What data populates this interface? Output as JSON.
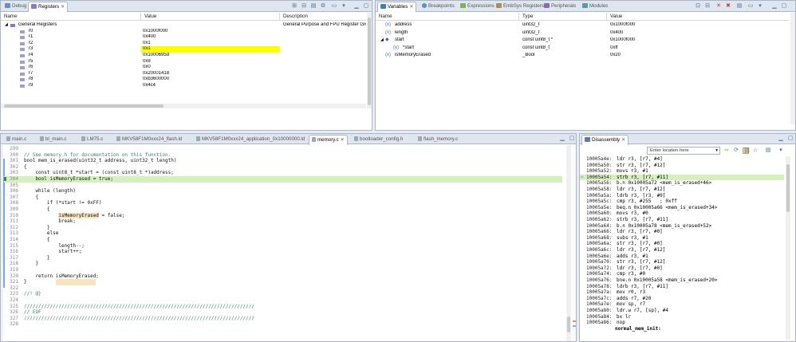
{
  "debug_view": {
    "tabs": [
      {
        "label": "Debug",
        "active": false
      },
      {
        "label": "Registers",
        "active": true
      }
    ],
    "columns": [
      "Name",
      "Value",
      "Description"
    ],
    "rows": [
      {
        "name": "General Registers",
        "value": "",
        "desc": "General Purpose and FPU Register Gro",
        "level": 0
      },
      {
        "name": "r0",
        "value": "0x1000f000",
        "desc": "",
        "level": 1
      },
      {
        "name": "r1",
        "value": "0x400",
        "desc": "",
        "level": 1
      },
      {
        "name": "r2",
        "value": "0x1",
        "desc": "",
        "level": 1
      },
      {
        "name": "r3",
        "value": "0x1",
        "desc": "",
        "level": 1,
        "highlight": true
      },
      {
        "name": "r4",
        "value": "0x1000695d",
        "desc": "",
        "level": 1
      },
      {
        "name": "r5",
        "value": "0x9",
        "desc": "",
        "level": 1
      },
      {
        "name": "r6",
        "value": "0x0",
        "desc": "",
        "level": 1
      },
      {
        "name": "r7",
        "value": "0x20001418",
        "desc": "",
        "level": 1
      },
      {
        "name": "r8",
        "value": "0xb3600000",
        "desc": "",
        "level": 1
      },
      {
        "name": "r9",
        "value": "0x4c4",
        "desc": "",
        "level": 1
      }
    ]
  },
  "variables_view": {
    "tabs": [
      {
        "label": "Variables",
        "active": true
      },
      {
        "label": "Breakpoints",
        "active": false
      },
      {
        "label": "Expressions",
        "active": false
      },
      {
        "label": "EmbSys Registers",
        "active": false
      },
      {
        "label": "Peripherals",
        "active": false
      },
      {
        "label": "Modules",
        "active": false
      }
    ],
    "columns": [
      "Name",
      "Type",
      "Value"
    ],
    "rows": [
      {
        "name": "address",
        "type": "uint32_t",
        "value": "0x1000f000",
        "level": 0
      },
      {
        "name": "length",
        "type": "uint32_t",
        "value": "0x400",
        "level": 0
      },
      {
        "name": "start",
        "type": "const uint8_t *",
        "value": "0x1000f000",
        "level": 0,
        "expanded": true
      },
      {
        "name": "*start",
        "type": "const uint8_t",
        "value": "0xff",
        "level": 1
      },
      {
        "name": "isMemoryErased",
        "type": "_Bool",
        "value": "0x20",
        "level": 0
      }
    ]
  },
  "editor": {
    "tabs": [
      {
        "label": "main.c",
        "active": false
      },
      {
        "label": "bl_main.c",
        "active": false
      },
      {
        "label": "LM75.c",
        "active": false
      },
      {
        "label": "MKV58F1M0xxx24_flash.ld",
        "active": false
      },
      {
        "label": "MKV58F1M0xxx24_application_0x10000000.ld",
        "active": false
      },
      {
        "label": "memory.c",
        "active": true
      },
      {
        "label": "bootloader_config.h",
        "active": false
      },
      {
        "label": "flash_memory.c",
        "active": false
      }
    ],
    "lines": [
      {
        "n": "299",
        "t": ""
      },
      {
        "n": "300",
        "t": "// See memory.h for documentation on this function.",
        "cls": "cmt"
      },
      {
        "n": "301",
        "t": "bool mem_is_erased(uint32_t address, uint32_t length)"
      },
      {
        "n": "302",
        "t": "{"
      },
      {
        "n": "303",
        "t": "    const uint8_t *start = (const uint8_t *)address;"
      },
      {
        "n": "304",
        "t": "    bool isMemoryErased = true;",
        "current": true
      },
      {
        "n": "305",
        "t": ""
      },
      {
        "n": "306",
        "t": "    while (length)"
      },
      {
        "n": "307",
        "t": "    {"
      },
      {
        "n": "308",
        "t": "        if (*start != 0xFF)"
      },
      {
        "n": "309",
        "t": "        {"
      },
      {
        "n": "310",
        "t": "            isMemoryErased = false;"
      },
      {
        "n": "311",
        "t": "            break;"
      },
      {
        "n": "312",
        "t": "        }"
      },
      {
        "n": "313",
        "t": "        else"
      },
      {
        "n": "314",
        "t": "        {"
      },
      {
        "n": "315",
        "t": "            length--;"
      },
      {
        "n": "316",
        "t": "            start++;"
      },
      {
        "n": "317",
        "t": "        }"
      },
      {
        "n": "318",
        "t": "    }"
      },
      {
        "n": "319",
        "t": ""
      },
      {
        "n": "320",
        "t": "    return isMemoryErased;"
      },
      {
        "n": "321",
        "t": "}"
      },
      {
        "n": "322",
        "t": ""
      },
      {
        "n": "323",
        "t": "//! @}",
        "cls": "cmt"
      },
      {
        "n": "324",
        "t": ""
      },
      {
        "n": "325",
        "t": "////////////////////////////////////////////////////////////////////////////////",
        "cls": "cmt"
      },
      {
        "n": "326",
        "t": "// EOF",
        "cls": "cmt"
      },
      {
        "n": "327",
        "t": "////////////////////////////////////////////////////////////////////////////////",
        "cls": "cmt"
      },
      {
        "n": "328",
        "t": ""
      }
    ]
  },
  "disassembly": {
    "tab_label": "Disassembly",
    "location_placeholder": "Enter location here",
    "lines": [
      {
        "a": "10005a4e:",
        "i": "ldr r3, [r7, #4]"
      },
      {
        "a": "10005a50:",
        "i": "str r3, [r7, #12]"
      },
      {
        "a": "10005a52:",
        "i": "movs r3, #1"
      },
      {
        "a": "10005a54:",
        "i": "strb r3, [r7, #11]",
        "current": true
      },
      {
        "a": "10005a56:",
        "i": "b.n 0x10005a72 <mem_is_erased+46>"
      },
      {
        "a": "10005a58:",
        "i": "ldr r3, [r7, #12]"
      },
      {
        "a": "10005a5a:",
        "i": "ldrb r3, [r3, #0]"
      },
      {
        "a": "10005a5c:",
        "i": "cmp r3, #255   ; 0xff"
      },
      {
        "a": "10005a5e:",
        "i": "beq.n 0x10005a66 <mem_is_erased+34>"
      },
      {
        "a": "10005a60:",
        "i": "movs r3, #0"
      },
      {
        "a": "10005a62:",
        "i": "strb r3, [r7, #11]"
      },
      {
        "a": "10005a64:",
        "i": "b.n 0x10005a78 <mem_is_erased+52>"
      },
      {
        "a": "10005a66:",
        "i": "ldr r3, [r7, #0]"
      },
      {
        "a": "10005a68:",
        "i": "subs r3, #1"
      },
      {
        "a": "10005a6a:",
        "i": "str r3, [r7, #0]"
      },
      {
        "a": "10005a6c:",
        "i": "ldr r3, [r7, #12]"
      },
      {
        "a": "10005a6e:",
        "i": "adds r3, #1"
      },
      {
        "a": "10005a70:",
        "i": "str r3, [r7, #12]"
      },
      {
        "a": "10005a72:",
        "i": "ldr r3, [r7, #0]"
      },
      {
        "a": "10005a74:",
        "i": "cmp r3, #0"
      },
      {
        "a": "10005a76:",
        "i": "bne.n 0x10005a58 <mem_is_erased+20>"
      },
      {
        "a": "10005a78:",
        "i": "ldrb r3, [r7, #11]"
      },
      {
        "a": "10005a7a:",
        "i": "mov r0, r3"
      },
      {
        "a": "10005a7c:",
        "i": "adds r7, #20"
      },
      {
        "a": "10005a7e:",
        "i": "mov sp, r7"
      },
      {
        "a": "10005a80:",
        "i": "ldr.w r7, [sp], #4"
      },
      {
        "a": "10005a84:",
        "i": "bx lr"
      },
      {
        "a": "10005a86:",
        "i": "nop"
      },
      {
        "a": "",
        "i": "normal_mem_init:",
        "label": true
      }
    ]
  },
  "colors": {
    "highlight_yellow": "#ffff00",
    "current_line": "#d5efbf",
    "var_highlight": "#f5d9a8",
    "accent": "#4a6a8f"
  }
}
